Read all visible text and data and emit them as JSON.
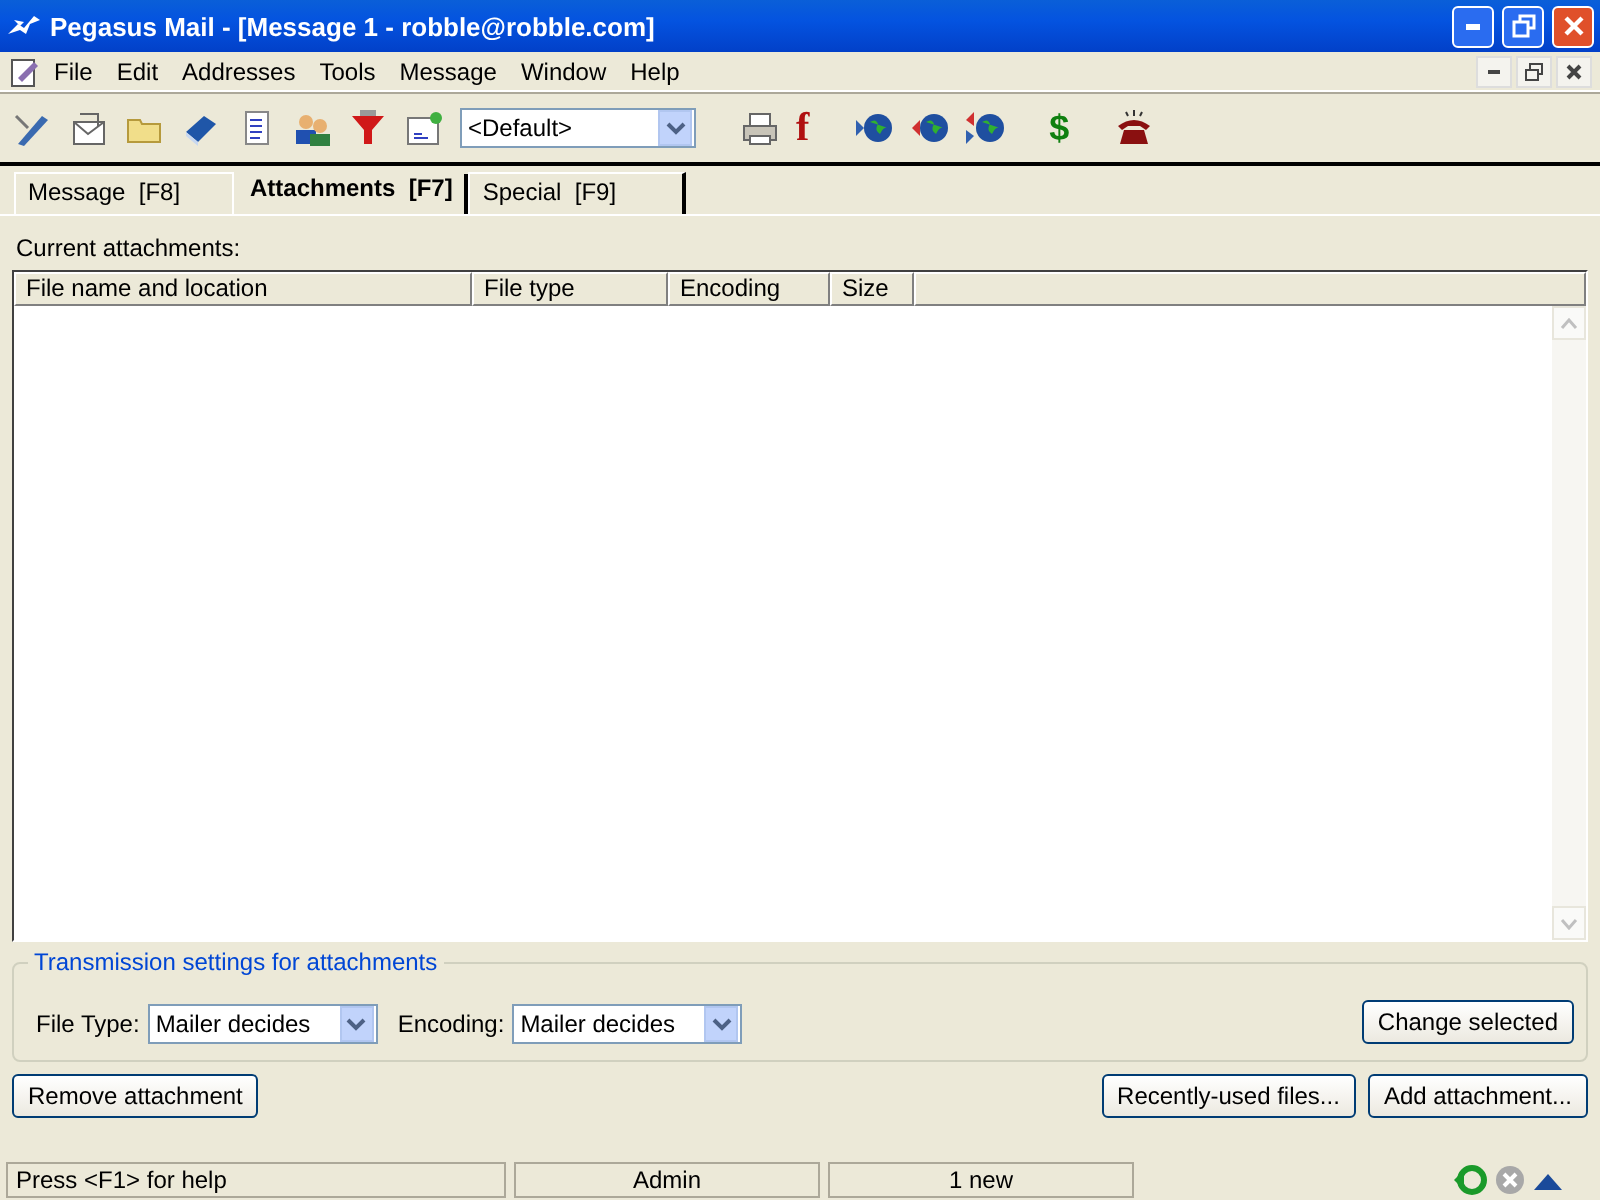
{
  "window": {
    "title": "Pegasus Mail - [Message 1 - robble@robble.com]"
  },
  "menu": [
    "File",
    "Edit",
    "Addresses",
    "Tools",
    "Message",
    "Window",
    "Help"
  ],
  "toolbar": {
    "combo_value": "<Default>",
    "font_glyph": "f",
    "money_glyph": "$"
  },
  "tabs": [
    {
      "label": "Message  [F8]",
      "selected": false
    },
    {
      "label": "Attachments  [F7]",
      "selected": true
    },
    {
      "label": "Special  [F9]",
      "selected": false
    }
  ],
  "attachments": {
    "label": "Current attachments:",
    "columns": [
      "File name and location",
      "File type",
      "Encoding",
      "Size"
    ]
  },
  "transmission": {
    "title": "Transmission settings for attachments",
    "file_type_label": "File Type:",
    "file_type_value": "Mailer decides",
    "encoding_label": "Encoding:",
    "encoding_value": "Mailer decides",
    "change_button": "Change selected"
  },
  "buttons": {
    "remove": "Remove attachment",
    "recent": "Recently-used files...",
    "add": "Add attachment..."
  },
  "status_bar": [
    "Press <F1> for help",
    "Admin",
    "1 new"
  ]
}
